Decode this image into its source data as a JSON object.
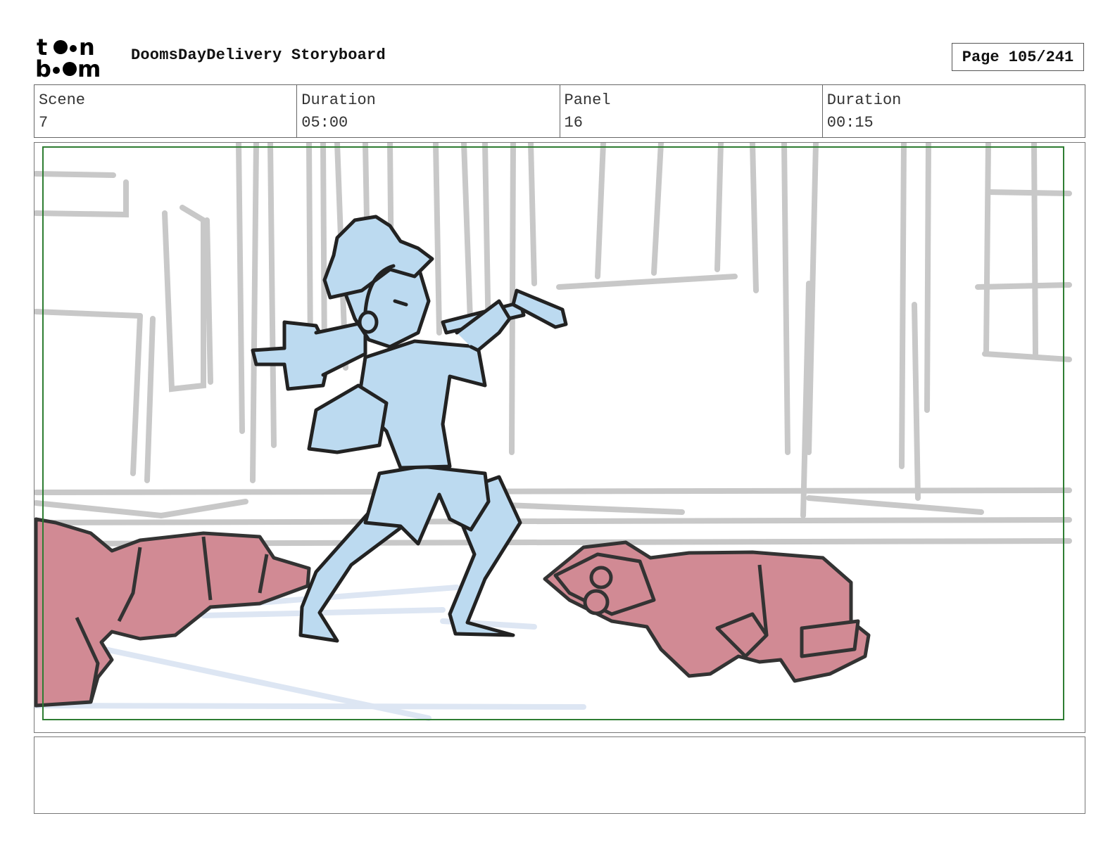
{
  "header": {
    "logo_text": "toon boom",
    "title": "DoomsDayDelivery Storyboard",
    "page_label": "Page 105/241"
  },
  "info": [
    {
      "label": "Scene",
      "value": "7"
    },
    {
      "label": "Duration",
      "value": "05:00"
    },
    {
      "label": "Panel",
      "value": "16"
    },
    {
      "label": "Duration",
      "value": "00:15"
    }
  ],
  "panel": {
    "safe_frame_color": "#2e7d32",
    "character_color": "#bcdaf0",
    "fallen_color": "#d18a94",
    "background_line_color": "#c4c4c4"
  },
  "notes": {
    "text": ""
  }
}
